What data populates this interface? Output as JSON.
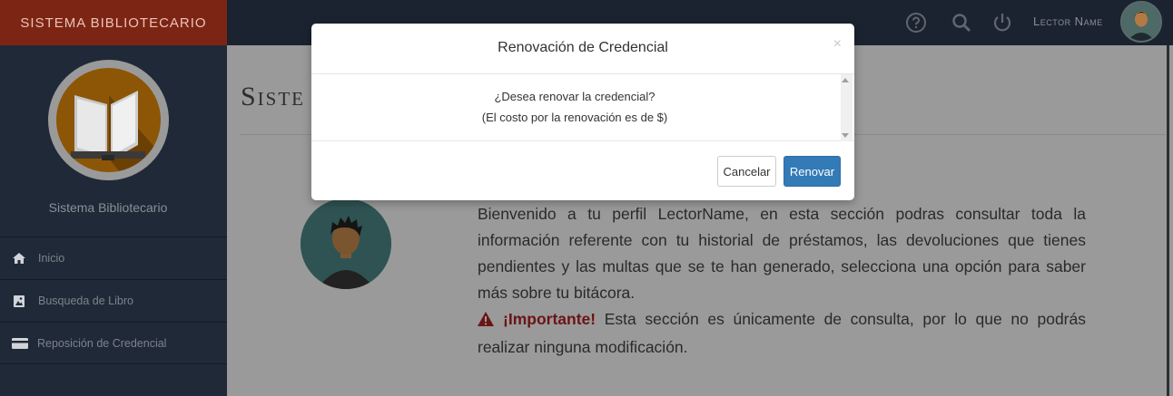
{
  "sidebar": {
    "brand": "Sistema Bibliotecario",
    "title": "Sistema Bibliotecario",
    "items": [
      {
        "label": "Inicio",
        "icon": "home-icon"
      },
      {
        "label": "Busqueda de Libro",
        "icon": "image-icon"
      },
      {
        "label": "Reposición de Credencial",
        "icon": "credit-card-icon"
      }
    ]
  },
  "topbar": {
    "icons": [
      "help-icon",
      "search-icon",
      "power-icon"
    ],
    "user_name": "Lector Name"
  },
  "content": {
    "title": "Siste",
    "welcome_text": "Bienvenido a tu perfil LectorName, en esta sección podras consultar toda la información referente con tu historial de préstamos, las devoluciones que tienes pendientes y las multas que se te han generado, selecciona una opción para saber más sobre tu bitácora.",
    "important_label": "¡Importante!",
    "important_text": " Esta sección es únicamente de consulta, por lo que no podrás realizar ninguna modificación."
  },
  "modal": {
    "title": "Renovación de Credencial",
    "close": "×",
    "line1": "¿Desea renovar la credencial?",
    "line2": "(El costo por la renovación es de $)",
    "cancel_label": "Cancelar",
    "renew_label": "Renovar"
  },
  "colors": {
    "brand_bg": "#7d2514",
    "sidebar_bg": "#1f2938",
    "primary_button": "#337ab7",
    "important": "#6b1414"
  }
}
